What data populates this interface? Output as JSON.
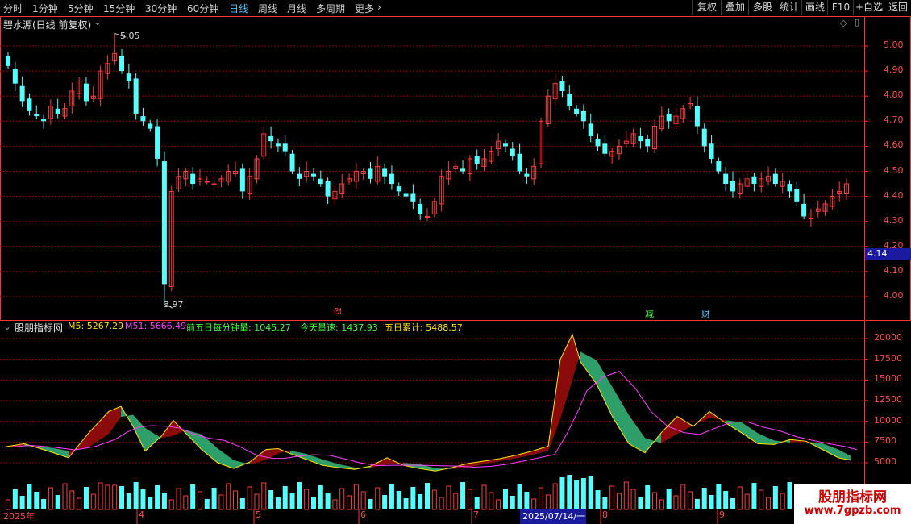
{
  "toolbar": {
    "periods": [
      "分时",
      "1分钟",
      "5分钟",
      "15分钟",
      "30分钟",
      "60分钟",
      "日线",
      "周线",
      "月线",
      "多周期",
      "更多"
    ],
    "active_period": "日线",
    "buttons": [
      "复权",
      "叠加",
      "多股",
      "统计",
      "画线",
      "F10",
      "+自选",
      "返回"
    ]
  },
  "main_panel": {
    "title": "碧水源(日线 前复权)",
    "price_labels": [
      "5.00",
      "4.90",
      "4.80",
      "4.70",
      "4.60",
      "4.50",
      "4.40",
      "4.30",
      "4.20",
      "4.10",
      "4.00"
    ],
    "current_price": "4.14",
    "high_annotation": "5.05",
    "low_annotation": "3.97",
    "event_markers": [
      "减",
      "财"
    ]
  },
  "indicator_panel": {
    "name": "股朋指标网",
    "items": [
      {
        "label": "M5: 5267.29",
        "color": "#ffe600"
      },
      {
        "label": "M51: 5666.49",
        "color": "#ff3cff"
      },
      {
        "label": "前五日每分钟量: 1045.27",
        "color": "#3cff3c"
      },
      {
        "label": "今天量速: 1437.93",
        "color": "#3cff3c"
      },
      {
        "label": "五日累计: 5488.57",
        "color": "#ffe600"
      }
    ],
    "axis_labels": [
      "20000",
      "17500",
      "15000",
      "12500",
      "10000",
      "7500",
      "5000"
    ]
  },
  "date_axis": {
    "labels": [
      "2025年",
      "4",
      "5",
      "6",
      "7",
      "8",
      "9"
    ],
    "cursor_date": "2025/07/14/一"
  },
  "watermark": {
    "title": "股朋指标网",
    "url": "www.7gpzb.com"
  },
  "colors": {
    "up": "#ff3c3c",
    "down": "#54ffff",
    "grid": "#8a0000",
    "axis": "#ff3232",
    "background": "#000000"
  },
  "chart_data": {
    "type": "candlestick",
    "series": [
      {
        "name": "price",
        "values": [
          4.92,
          4.85,
          4.78,
          4.74,
          4.72,
          4.7,
          4.76,
          4.73,
          4.75,
          4.82,
          4.86,
          4.78,
          4.8,
          4.9,
          4.93,
          4.97,
          4.9,
          4.86,
          4.73,
          4.7,
          4.67,
          4.55,
          4.05,
          4.42,
          4.48,
          4.5,
          4.45,
          4.47,
          4.46,
          4.45,
          4.47,
          4.5,
          4.5,
          4.42,
          4.48,
          4.55,
          4.65,
          4.62,
          4.6,
          4.58,
          4.5,
          4.47,
          4.5,
          4.48,
          4.45,
          4.4,
          4.42,
          4.45,
          4.47,
          4.5,
          4.5,
          4.47,
          4.52,
          4.48,
          4.45,
          4.42,
          4.4,
          4.38,
          4.33,
          4.32,
          4.38,
          4.48,
          4.5,
          4.52,
          4.5,
          4.55,
          4.53,
          4.55,
          4.58,
          4.62,
          4.6,
          4.56,
          4.5,
          4.48,
          4.52,
          4.7,
          4.8,
          4.85,
          4.82,
          4.76,
          4.73,
          4.7,
          4.64,
          4.6,
          4.57,
          4.58,
          4.6,
          4.62,
          4.65,
          4.62,
          4.6,
          4.68,
          4.72,
          4.7,
          4.72,
          4.75,
          4.77,
          4.68,
          4.6,
          4.55,
          4.5,
          4.45,
          4.42,
          4.45,
          4.47,
          4.45,
          4.47,
          4.48,
          4.45,
          4.46,
          4.42,
          4.38,
          4.32,
          4.33,
          4.35,
          4.37,
          4.4,
          4.42,
          4.45
        ]
      }
    ],
    "ylim": [
      3.94,
      5.06
    ],
    "indicator_ylim": [
      3500,
      21000
    ]
  }
}
